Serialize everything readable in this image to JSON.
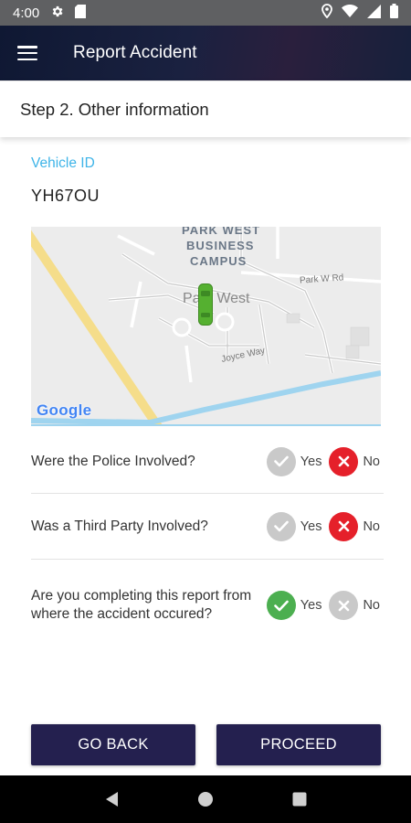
{
  "status_bar": {
    "time": "4:00",
    "icons": [
      "gear-icon",
      "sd-card-icon",
      "location-icon",
      "wifi-icon",
      "signal-icon",
      "battery-icon"
    ]
  },
  "app_bar": {
    "title": "Report Accident",
    "menu_icon": "hamburger-menu-icon"
  },
  "step_header": {
    "title": "Step 2. Other information"
  },
  "vehicle": {
    "label": "Vehicle ID",
    "value": "YH67OU"
  },
  "map": {
    "labels": {
      "campus_line1": "PARK WEST",
      "campus_line2": "BUSINESS",
      "campus_line3": "CAMPUS",
      "area": "Park West",
      "road1": "Park W Rd",
      "road2": "Joyce Way"
    },
    "logo": "Google",
    "marker_icon": "car-icon"
  },
  "questions": [
    {
      "text": "Were the Police Involved?",
      "yes_label": "Yes",
      "no_label": "No",
      "selected": "no"
    },
    {
      "text": "Was a Third Party Involved?",
      "yes_label": "Yes",
      "no_label": "No",
      "selected": "no"
    },
    {
      "text": "Are you completing this report from where the accident occured?",
      "yes_label": "Yes",
      "no_label": "No",
      "selected": "yes"
    }
  ],
  "buttons": {
    "back": "GO BACK",
    "proceed": "PROCEED"
  },
  "colors": {
    "accent": "#3eb4e8",
    "primary_button": "#24204f",
    "selected_no": "#e5202a",
    "selected_yes": "#4caf50",
    "unselected": "#c9c9c9"
  },
  "nav_bar": {
    "icons": [
      "back-triangle-icon",
      "home-circle-icon",
      "recents-square-icon"
    ]
  }
}
